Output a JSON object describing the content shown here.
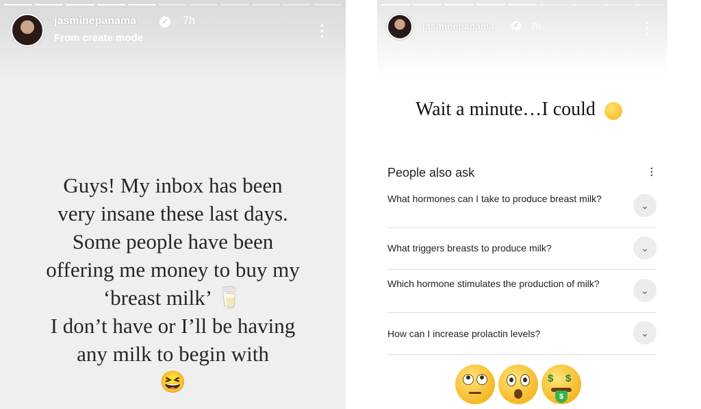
{
  "left_story": {
    "progress_segments": [
      1,
      1,
      1,
      1,
      1,
      0,
      0,
      0,
      0,
      0,
      0
    ],
    "username": "jasminepanama",
    "time": "7h",
    "subtitle": "From create mode",
    "caption_lines": [
      "Guys! My inbox has been",
      "very insane these last days.",
      "Some people have been",
      "offering me money to buy my",
      "‘breast milk’ 🥛",
      "I don’t have or I’ll be having",
      "any milk to begin with",
      "😆"
    ]
  },
  "right_story": {
    "progress_segments": [
      1,
      1,
      1,
      1,
      1,
      0,
      0,
      0,
      0
    ],
    "username": "jasminepanama",
    "time": "7h",
    "headline": "Wait a minute…I could",
    "people_also_ask": {
      "title": "People also ask",
      "questions": [
        "What hormones can I take to produce breast milk?",
        "What triggers breasts to produce milk?",
        "Which hormone stimulates the production of milk?",
        "How can I increase prolactin levels?"
      ]
    },
    "emoji_stickers": [
      "eye-roll-emoji",
      "astonished-emoji",
      "money-mouth-emoji"
    ]
  }
}
